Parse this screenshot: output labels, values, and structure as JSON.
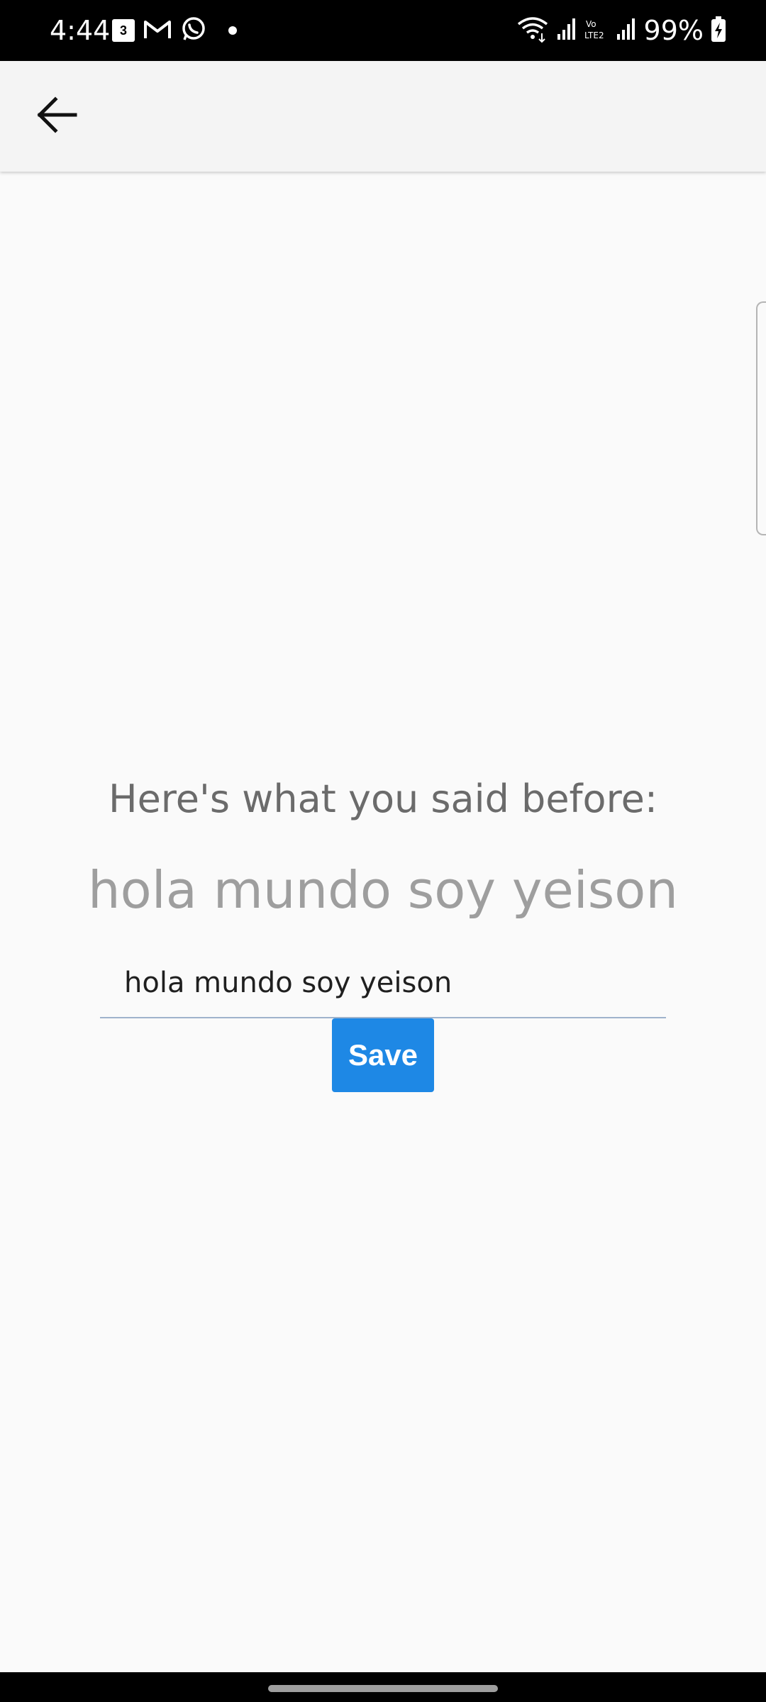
{
  "status_bar": {
    "time": "4:44",
    "calendar_badge": "3",
    "battery": "99%",
    "left_icons": [
      "calendar-icon",
      "gmail-icon",
      "whatsapp-icon",
      "dot-icon"
    ],
    "right_icons": [
      "wifi-icon",
      "signal-icon",
      "volte-icon",
      "signal-icon",
      "battery-charging-icon"
    ]
  },
  "app_bar": {
    "back_icon": "arrow-back-icon"
  },
  "main": {
    "heading": "Here's what you said before:",
    "saved_value": "hola mundo soy yeison",
    "input_value": "hola mundo soy yeison",
    "save_label": "Save"
  },
  "colors": {
    "accent": "#1e88e5",
    "background": "#fafafa",
    "app_bar": "#f4f4f4",
    "heading_text": "#6b6b6b",
    "saved_text": "#9e9e9e"
  }
}
